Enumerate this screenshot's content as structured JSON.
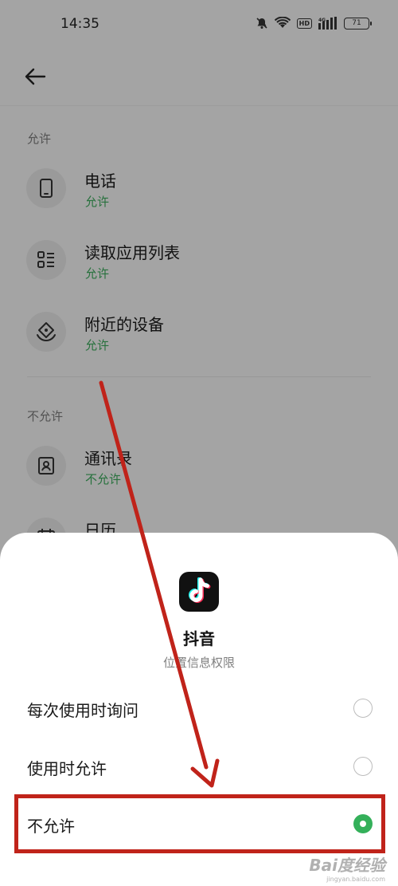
{
  "status_bar": {
    "time": "14:35",
    "hd": "HD",
    "network": "4G",
    "battery": "71",
    "icons": [
      "mute-icon",
      "wifi-icon",
      "hd-icon",
      "signal-icon",
      "battery-icon"
    ]
  },
  "header": {
    "back_icon": "arrow-left-icon"
  },
  "sections": {
    "allowed_label": "允许",
    "denied_label": "不允许"
  },
  "permissions_allowed": [
    {
      "title": "电话",
      "status": "允许",
      "icon": "phone-icon"
    },
    {
      "title": "读取应用列表",
      "status": "允许",
      "icon": "app-list-icon"
    },
    {
      "title": "附近的设备",
      "status": "允许",
      "icon": "nearby-devices-icon"
    }
  ],
  "permissions_denied": [
    {
      "title": "通讯录",
      "status": "不允许",
      "icon": "contacts-icon"
    },
    {
      "title": "日历",
      "status": "",
      "icon": "calendar-icon"
    }
  ],
  "sheet": {
    "app_name": "抖音",
    "subtitle": "位置信息权限",
    "options": [
      {
        "label": "每次使用时询问",
        "selected": false
      },
      {
        "label": "使用时允许",
        "selected": false
      },
      {
        "label": "不允许",
        "selected": true
      }
    ]
  },
  "colors": {
    "accent_green": "#34b05a",
    "status_green": "#3aa75a",
    "annotation_red": "#c0231a"
  },
  "watermark": {
    "main": "Bai度经验",
    "sub": "jingyan.baidu.com"
  }
}
